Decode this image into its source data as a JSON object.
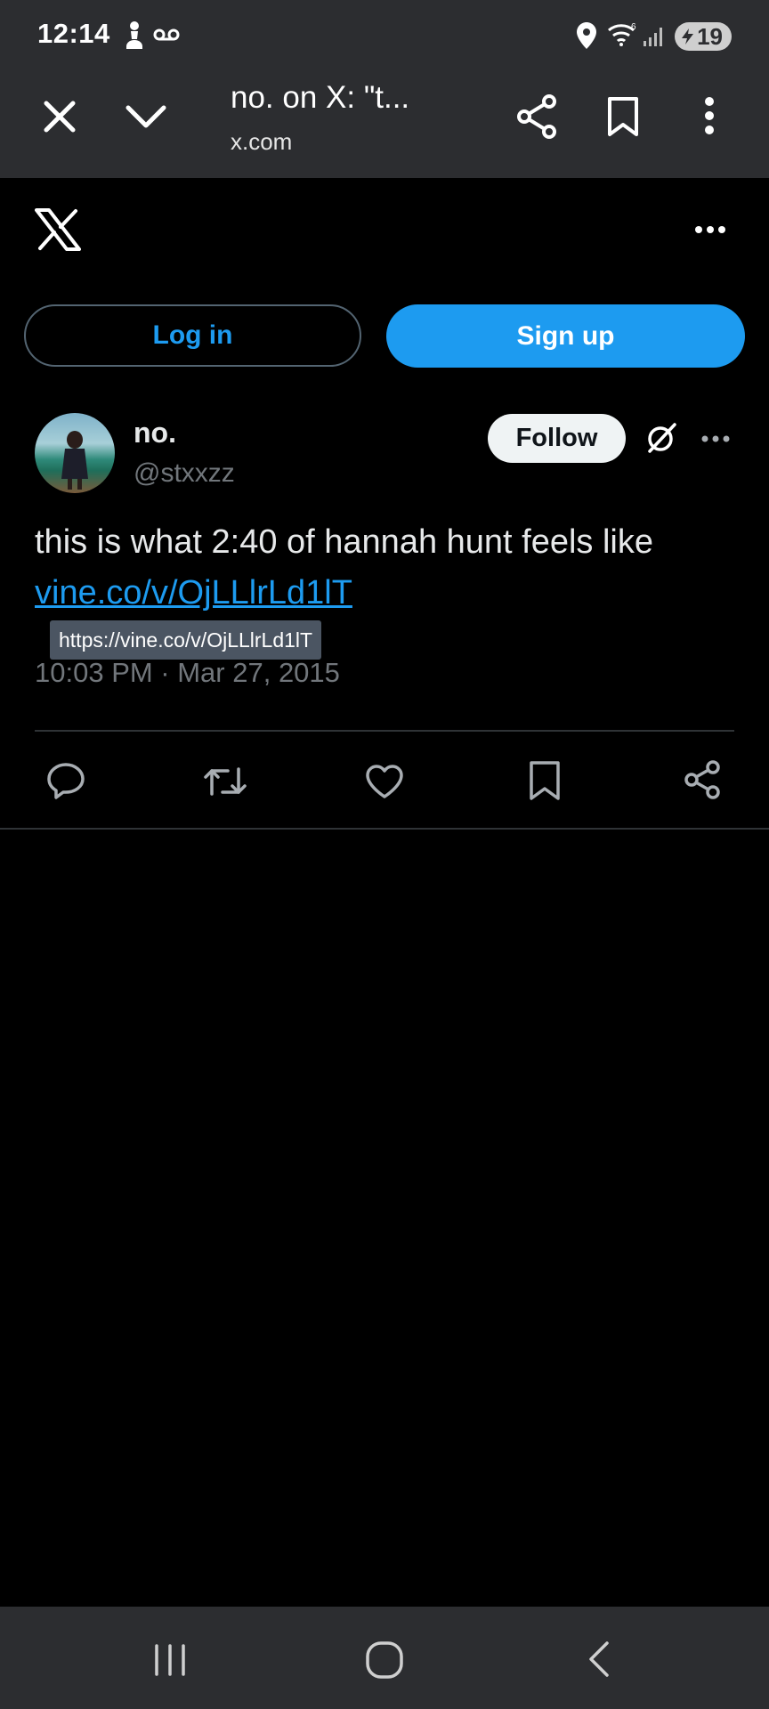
{
  "status_bar": {
    "time": "12:14",
    "battery": "19",
    "icons": [
      "chess-pawn-icon",
      "voicemail-icon",
      "location-icon",
      "wifi-icon",
      "signal-icon",
      "battery-icon"
    ]
  },
  "custom_tab": {
    "title": "no. on X: \"t...",
    "url": "x.com",
    "icons": [
      "close-icon",
      "chevron-down-icon",
      "share-icon",
      "bookmark-icon",
      "more-vertical-icon"
    ]
  },
  "x_header": {
    "logo": "x-logo",
    "more_icon": "more-horizontal-icon"
  },
  "auth": {
    "login_label": "Log in",
    "signup_label": "Sign up"
  },
  "tweet": {
    "author_name": "no.",
    "author_handle": "@stxxzz",
    "follow_label": "Follow",
    "text": "this is what 2:40 of hannah hunt feels like",
    "link_text": "vine.co/v/OjLLlrLd1lT",
    "link_tooltip": "https://vine.co/v/OjLLlrLd1lT",
    "timestamp": "10:03 PM · Mar 27, 2015",
    "actions": [
      "reply-icon",
      "retweet-icon",
      "like-icon",
      "bookmark-icon",
      "share-icon"
    ]
  },
  "colors": {
    "accent": "#1d9bf0",
    "background": "#000000",
    "chrome": "#2c2d30",
    "muted_text": "#71767b"
  },
  "nav_bar": {
    "icons": [
      "recent-apps-icon",
      "home-icon",
      "back-icon"
    ]
  }
}
